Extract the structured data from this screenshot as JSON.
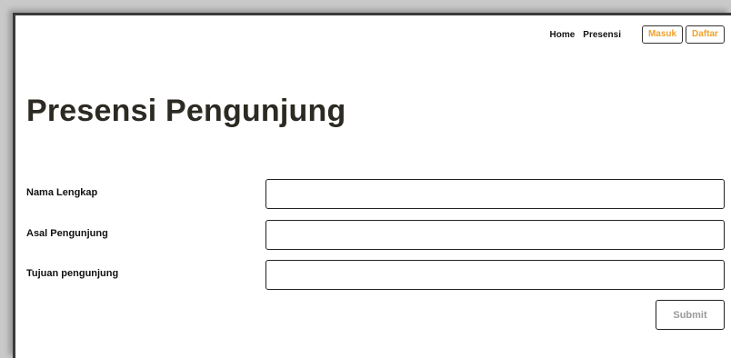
{
  "nav": {
    "home_label": "Home",
    "presence_label": "Presensi",
    "login_label": "Masuk",
    "register_label": "Daftar"
  },
  "page": {
    "title": "Presensi Pengunjung"
  },
  "form": {
    "fields": [
      {
        "label": "Nama Lengkap",
        "value": "",
        "placeholder": ""
      },
      {
        "label": "Asal Pengunjung",
        "value": "",
        "placeholder": ""
      },
      {
        "label": "Tujuan pengunjung",
        "value": "",
        "placeholder": ""
      }
    ],
    "submit_label": "Submit"
  },
  "colors": {
    "accent": "#f0a12a",
    "title": "#2c2a22",
    "submit_text": "#9a9a9a"
  }
}
